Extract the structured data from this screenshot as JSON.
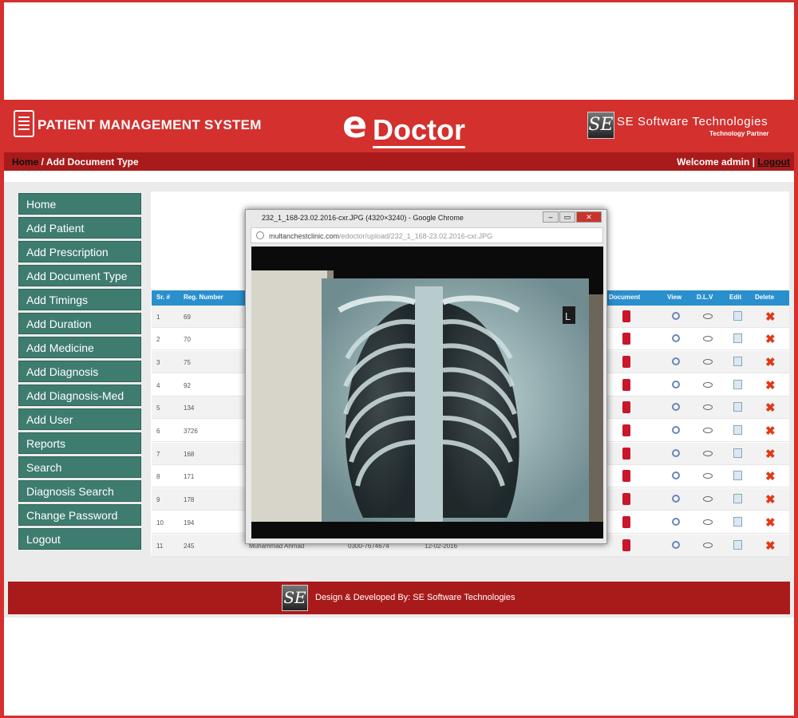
{
  "header": {
    "system_title": "PATIENT MANAGEMENT SYSTEM",
    "brand_e": "e",
    "brand_name": "Doctor",
    "company_logo": "SE",
    "company_name": "SE Software Technologies",
    "company_tagline": "Technology Partner"
  },
  "breadcrumb": {
    "home": "Home",
    "current": " / Add Document Type"
  },
  "user": {
    "welcome": "Welcome admin",
    "separator": " | ",
    "logout": "Logout"
  },
  "sidebar": {
    "items": [
      {
        "label": "Home"
      },
      {
        "label": "Add Patient"
      },
      {
        "label": "Add Prescription"
      },
      {
        "label": "Add Document Type"
      },
      {
        "label": "Add Timings"
      },
      {
        "label": "Add Duration"
      },
      {
        "label": "Add Medicine"
      },
      {
        "label": "Add Diagnosis"
      },
      {
        "label": "Add Diagnosis-Med"
      },
      {
        "label": "Add User"
      },
      {
        "label": "Reports"
      },
      {
        "label": "Search"
      },
      {
        "label": "Diagnosis Search"
      },
      {
        "label": "Change Password"
      },
      {
        "label": "Logout"
      }
    ]
  },
  "table": {
    "columns": {
      "sr": "Sr. #",
      "reg": "Reg. Number",
      "document": "Document",
      "view": "View",
      "dlv": "D.L.V",
      "edit": "Edit",
      "delete": "Delete"
    },
    "rows": [
      {
        "sr": "1",
        "reg": "69"
      },
      {
        "sr": "2",
        "reg": "70"
      },
      {
        "sr": "3",
        "reg": "75"
      },
      {
        "sr": "4",
        "reg": "92"
      },
      {
        "sr": "5",
        "reg": "134"
      },
      {
        "sr": "6",
        "reg": "3726"
      },
      {
        "sr": "7",
        "reg": "168"
      },
      {
        "sr": "8",
        "reg": "171"
      },
      {
        "sr": "9",
        "reg": "178"
      },
      {
        "sr": "10",
        "reg": "194"
      },
      {
        "sr": "11",
        "reg": "245",
        "name": "Muhammad Ahmad",
        "phone": "0300-7674674",
        "date": "12-02-2016"
      }
    ]
  },
  "popup": {
    "title": "232_1_168-23.02.2016-cxr.JPG (4320×3240) - Google Chrome",
    "url_host": "multanchestclinic.com",
    "url_path": "/edoctor/upload/232_1_168-23.02.2016-cxr.JPG",
    "minimize": "–",
    "maximize": "▭",
    "close": "✕",
    "image_marker": "L"
  },
  "footer": {
    "logo": "SE",
    "text": "Design & Developed By: SE Software Technologies"
  },
  "colors": {
    "brand_red": "#d3302e",
    "dark_red": "#a91b1b",
    "nav_green": "#3f7c70",
    "table_blue": "#2a8fcd"
  },
  "icons": {
    "document": "document-icon",
    "view": "magnifier-icon",
    "dlv": "eye-icon",
    "edit": "edit-icon",
    "delete": "delete-x-icon"
  }
}
